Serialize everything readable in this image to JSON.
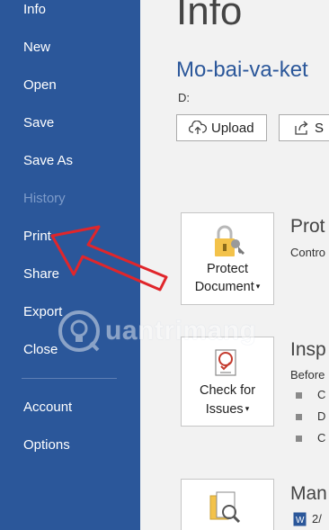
{
  "sidebar": {
    "items": [
      {
        "label": "Info",
        "state": "active"
      },
      {
        "label": "New"
      },
      {
        "label": "Open"
      },
      {
        "label": "Save"
      },
      {
        "label": "Save As"
      },
      {
        "label": "History",
        "state": "disabled"
      },
      {
        "label": "Print"
      },
      {
        "label": "Share"
      },
      {
        "label": "Export"
      },
      {
        "label": "Close"
      },
      {
        "label": "Account"
      },
      {
        "label": "Options"
      }
    ]
  },
  "main": {
    "title": "Info",
    "doc_name": "Mo-bai-va-ket",
    "path": "D:",
    "buttons": [
      {
        "label": "Upload",
        "icon": "cloud-upload-icon"
      },
      {
        "label": "S",
        "icon": "share-icon"
      }
    ],
    "sections": [
      {
        "card_label_1": "Protect",
        "card_label_2": "Document",
        "title": "Prot",
        "desc": "Contro",
        "icon": "lock-key-icon"
      },
      {
        "card_label_1": "Check for",
        "card_label_2": "Issues",
        "title": "Insp",
        "desc": "Before",
        "bullets": [
          "C",
          "D",
          "C"
        ],
        "icon": "inspect-document-icon"
      },
      {
        "title": "Man",
        "desc": "2/",
        "icon": "manage-document-icon"
      }
    ]
  },
  "watermark": {
    "text": "uantrimang",
    "icon": "lightbulb-icon"
  },
  "colors": {
    "sidebar": "#2b579a",
    "accent": "#2b579a",
    "arrow": "#e0262b"
  }
}
